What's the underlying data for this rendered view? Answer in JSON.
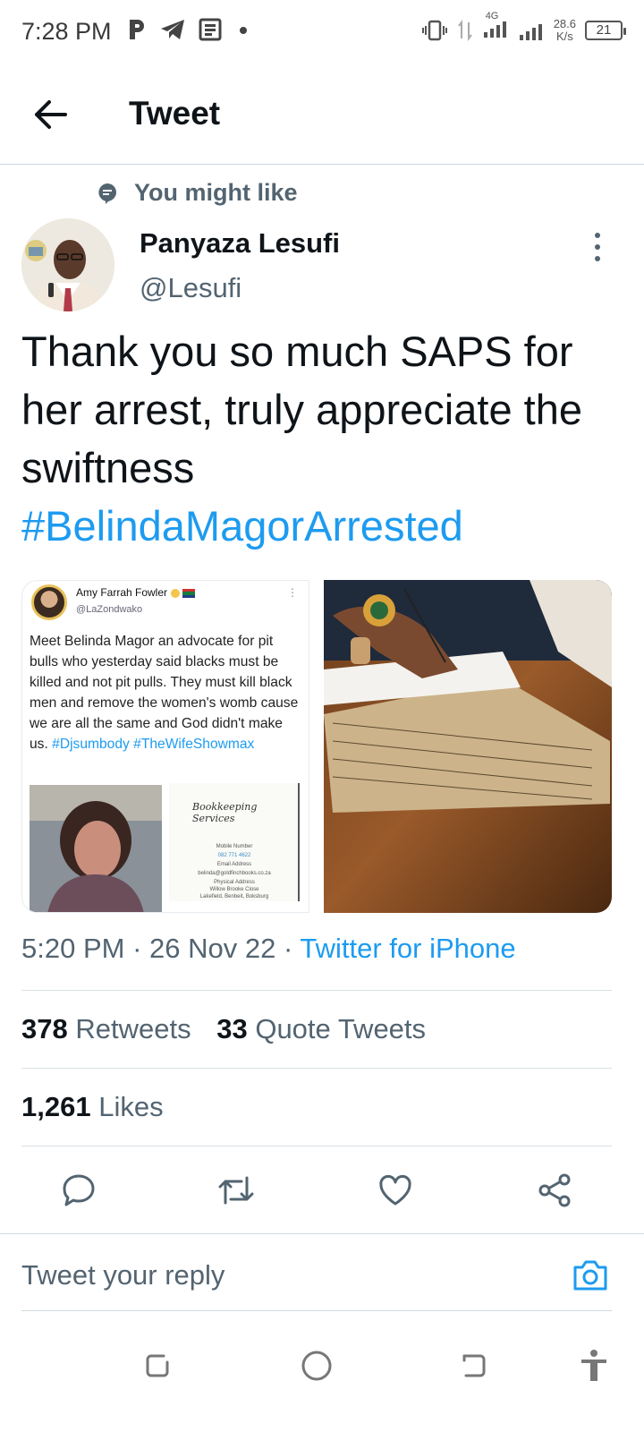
{
  "status_bar": {
    "time": "7:28 PM",
    "network_type": "4G",
    "speed_value": "28.6",
    "speed_unit": "K/s",
    "battery": "21",
    "icons": [
      "parking-icon",
      "telegram-icon",
      "news-icon",
      "dot-icon",
      "vibrate-icon",
      "data-arrows-icon",
      "signal-icon",
      "signal-icon-2"
    ]
  },
  "header": {
    "title": "Tweet",
    "back_icon": "back-arrow-icon"
  },
  "suggestion": {
    "label": "You might like",
    "icon": "topic-bubble-icon"
  },
  "author": {
    "name": "Panyaza Lesufi",
    "handle": "@Lesufi"
  },
  "tweet": {
    "text": "Thank you so much SAPS for her arrest, truly appreciate the swiftness",
    "hashtag": "#BelindaMagorArrested"
  },
  "media": {
    "embedded_tweet": {
      "name": "Amy Farrah Fowler",
      "handle": "@LaZondwako",
      "text": "Meet Belinda Magor an advocate for pit bulls who yesterday said blacks must be killed and not pit pulls. They must kill black men and remove the women's womb cause we are all the same and God didn't make us.",
      "tags": "#Djsumbody #TheWifeShowmax",
      "card": {
        "logo": "Bookkeeping Services",
        "mobile_label": "Mobile Number",
        "mobile_value": "082 771 4622",
        "email_label": "Email Address",
        "email_value": "belinda@goldfinchbooks.co.za",
        "address_label": "Physical Address",
        "address_line1": "Willow Brooke Close",
        "address_line2": "Lakefield, Benbeit, Boksburg"
      }
    }
  },
  "meta": {
    "time": "5:20 PM",
    "date": "26 Nov 22",
    "separator": "·",
    "source": "Twitter for iPhone"
  },
  "stats": {
    "retweets_count": "378",
    "retweets_label": "Retweets",
    "quotes_count": "33",
    "quotes_label": "Quote Tweets",
    "likes_count": "1,261",
    "likes_label": "Likes"
  },
  "actions": [
    "reply-icon",
    "retweet-icon",
    "like-icon",
    "share-icon"
  ],
  "reply": {
    "placeholder": "Tweet your reply"
  },
  "colors": {
    "accent": "#1d9bf0",
    "text": "#0f1419",
    "secondary": "#536471",
    "divider": "#cfd9de"
  }
}
